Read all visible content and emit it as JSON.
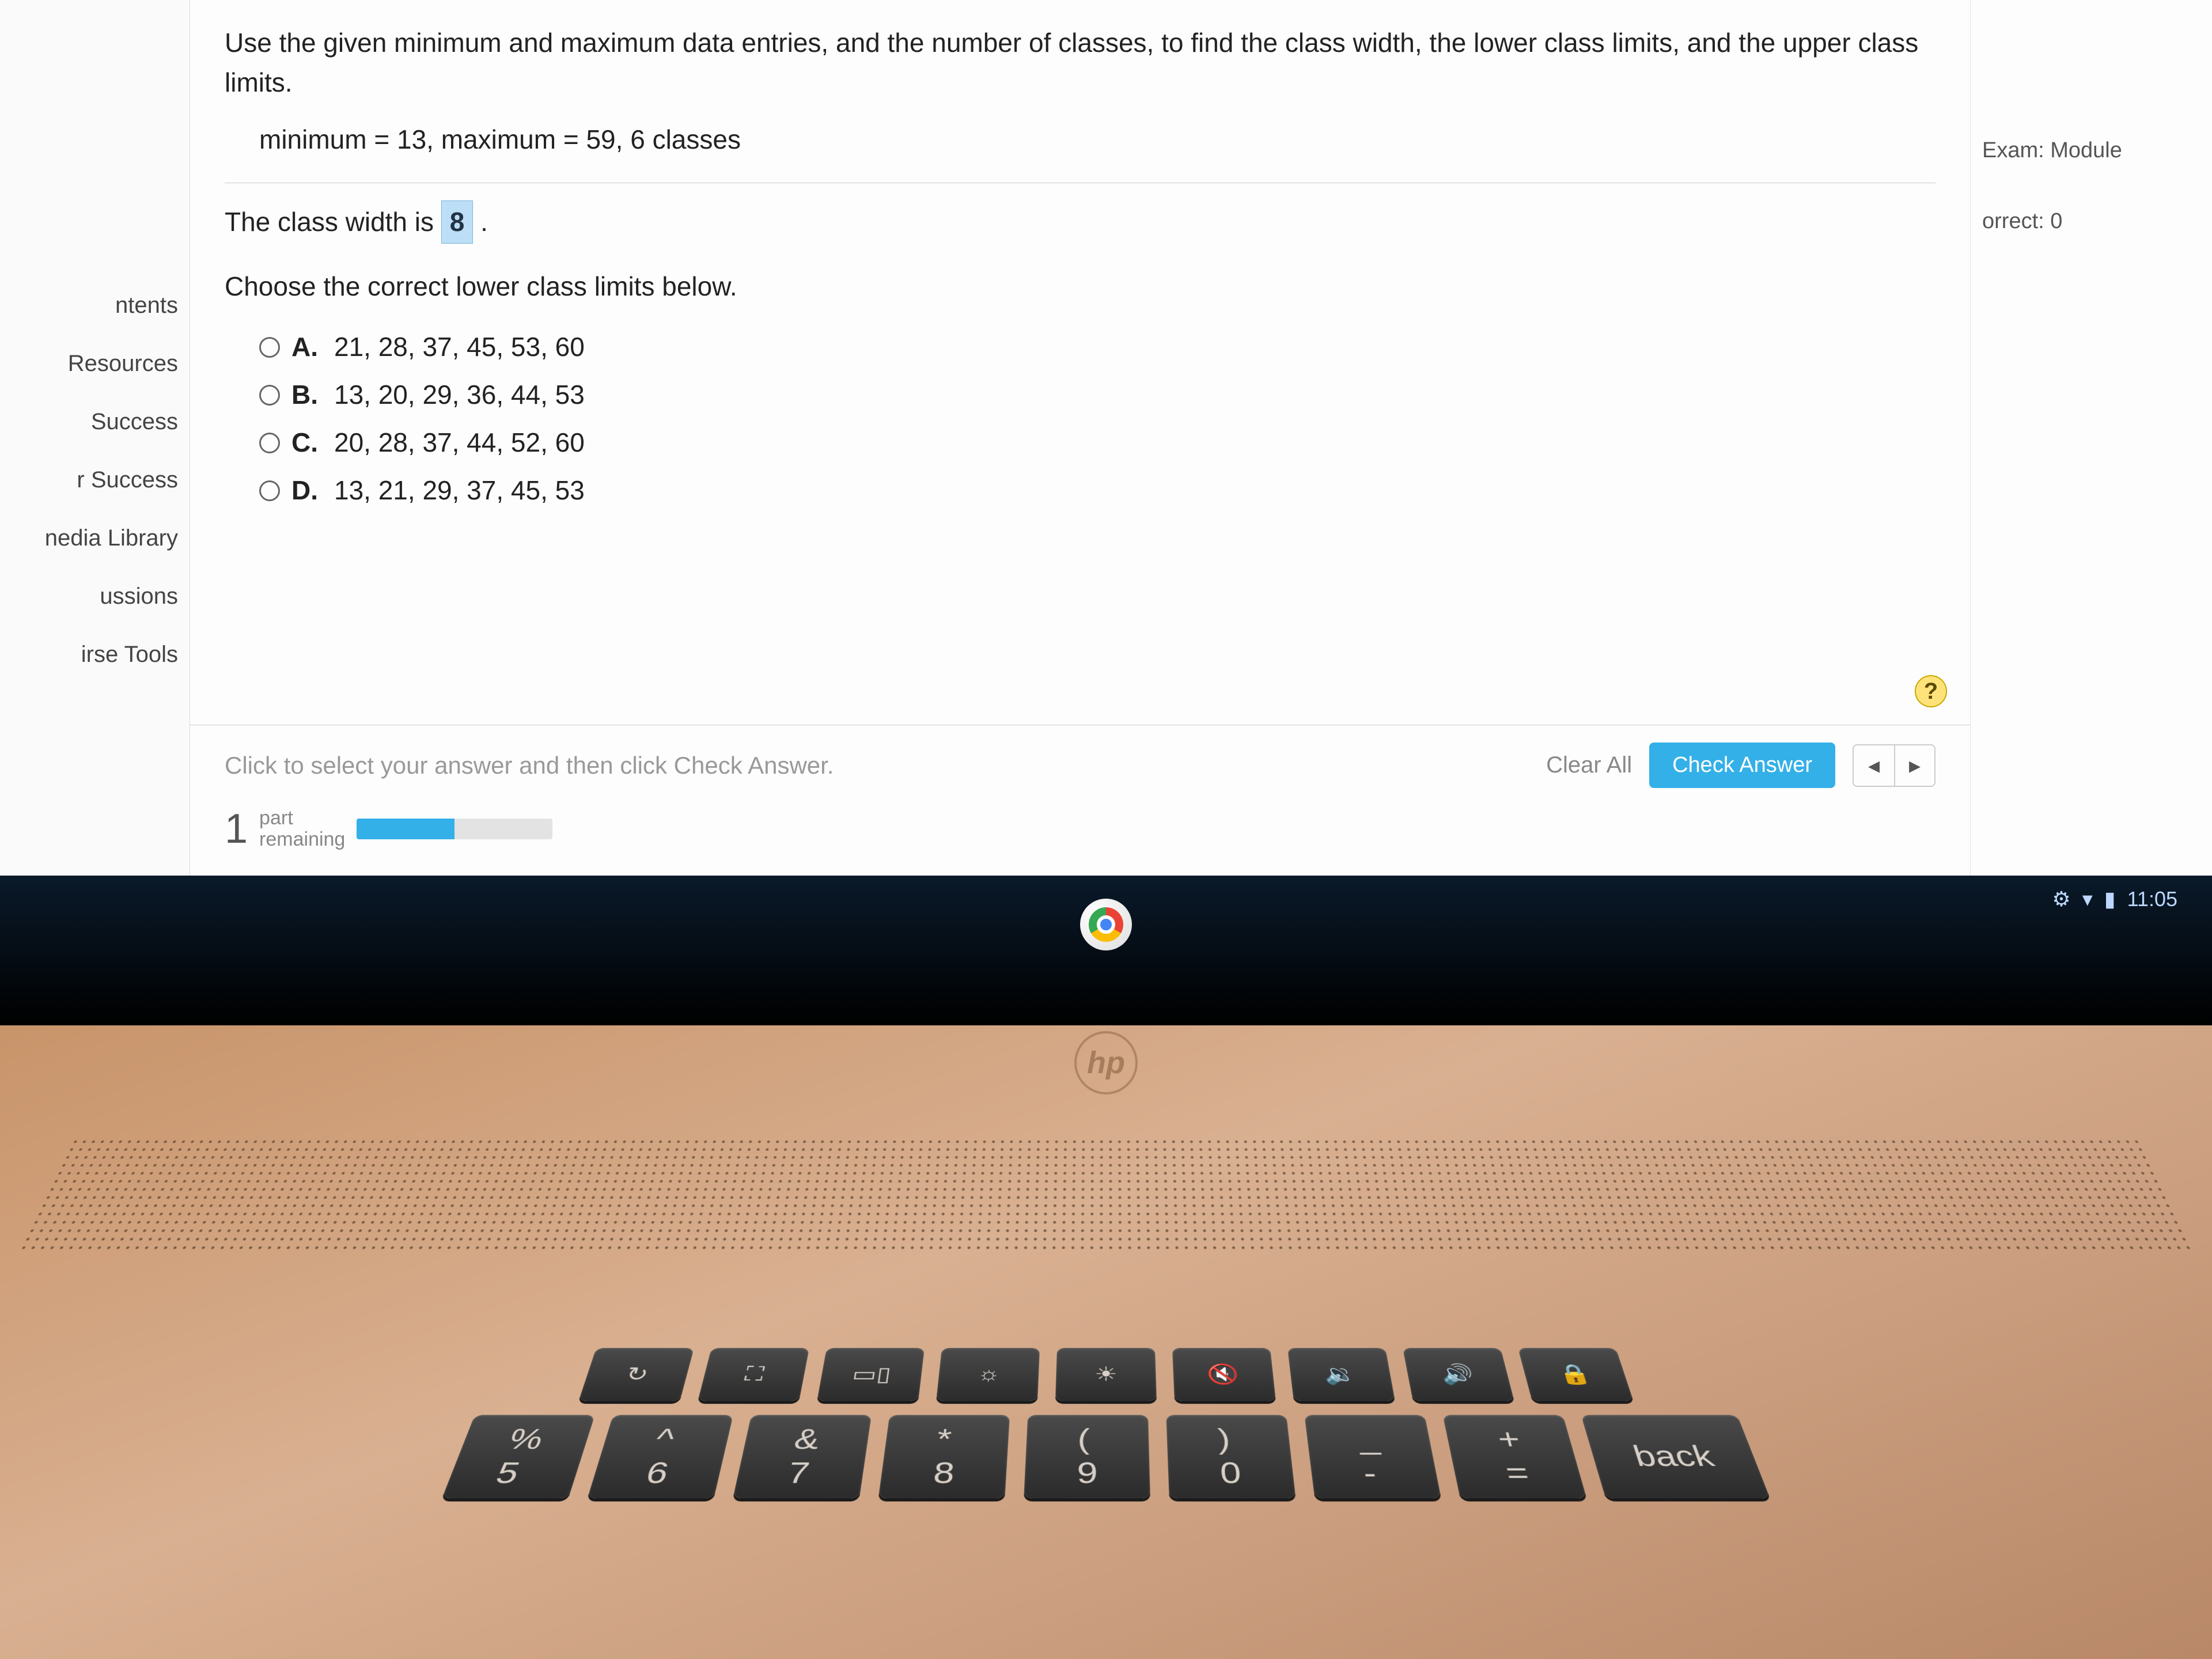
{
  "sidebar": {
    "items": [
      {
        "label": "ntents"
      },
      {
        "label": "Resources"
      },
      {
        "label": "Success"
      },
      {
        "label": "r Success"
      },
      {
        "label": "nedia Library"
      },
      {
        "label": "ussions"
      },
      {
        "label": "irse Tools"
      }
    ]
  },
  "rightcol": {
    "exam": "Exam: Module",
    "correct": "orrect: 0"
  },
  "question": {
    "prompt": "Use the given minimum and maximum data entries, and the number of classes, to find the class width, the lower class limits, and the upper class limits.",
    "given": "minimum = 13,  maximum = 59, 6 classes",
    "class_width_pre": "The class width is ",
    "class_width_value": "8",
    "class_width_post": " .",
    "choose": "Choose the correct lower class limits below.",
    "options": [
      {
        "letter": "A.",
        "text": "21, 28, 37, 45, 53, 60"
      },
      {
        "letter": "B.",
        "text": "13, 20, 29, 36, 44, 53"
      },
      {
        "letter": "C.",
        "text": "20, 28, 37, 44, 52, 60"
      },
      {
        "letter": "D.",
        "text": "13, 21, 29, 37, 45, 53"
      }
    ]
  },
  "footer": {
    "instruction": "Click to select your answer and then click Check Answer.",
    "clear": "Clear All",
    "check": "Check Answer",
    "prev": "◂",
    "next": "▸",
    "part_count": "1",
    "part_label_1": "part",
    "part_label_2": "remaining"
  },
  "help": "?",
  "tray": {
    "time": "11:05"
  },
  "hp": "hp"
}
